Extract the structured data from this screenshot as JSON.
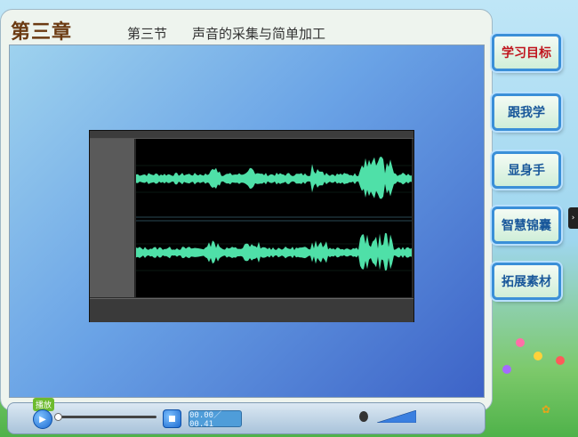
{
  "header": {
    "chapter": "第三章",
    "section": "第三节",
    "title": "声音的采集与简单加工"
  },
  "sidebar": {
    "items": [
      {
        "label": "学习目标",
        "active": true
      },
      {
        "label": "跟我学",
        "active": false
      },
      {
        "label": "显身手",
        "active": false
      },
      {
        "label": "智慧锦囊",
        "active": false
      },
      {
        "label": "拓展素材",
        "active": false
      }
    ]
  },
  "player": {
    "play_tag": "播放",
    "time": "00.00／00.41",
    "play_icon": "play-icon",
    "stop_icon": "stop-icon",
    "volume_icon": "speaker-icon",
    "progress": 0.0
  },
  "colors": {
    "accent": "#3a8fd8",
    "active_label": "#c0141d",
    "waveform": "#4fe0a8"
  }
}
